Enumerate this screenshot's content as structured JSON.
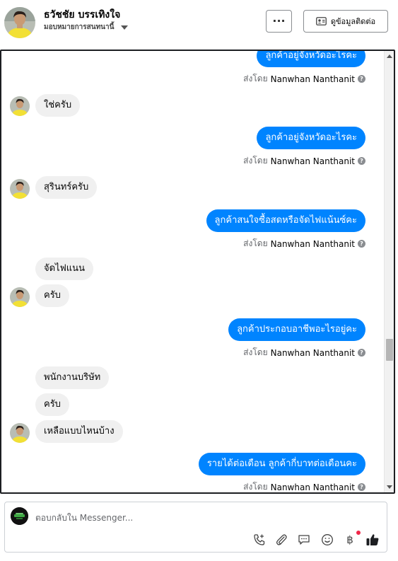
{
  "header": {
    "contact_name": "ธวัชชัย บรรเทิงใจ",
    "assign_label": "มอบหมายการสนทนานี้",
    "more_label": "···",
    "contact_info_label": "ดูข้อมูลติดต่อ"
  },
  "thread": {
    "sent_prefix": "ส่งโดย",
    "agent_name": "Nanwhan Nanthanit",
    "help_glyph": "?",
    "messages": [
      {
        "dir": "out",
        "text": "ลูกค้าอยู่จังหวัดอะไรคะ"
      },
      {
        "dir": "in",
        "text": "ใช่ครับ"
      },
      {
        "dir": "out",
        "text": "ลูกค้าอยู่จังหวัดอะไรคะ"
      },
      {
        "dir": "in",
        "text": "สุรินทร์ครับ"
      },
      {
        "dir": "out",
        "text": "ลูกค้าสนใจซื้อสดหรือจัดไฟแน้นซ์คะ"
      },
      {
        "dir": "in",
        "text": "จัดไฟแนน"
      },
      {
        "dir": "in",
        "text": "ครับ"
      },
      {
        "dir": "out",
        "text": "ลูกค้าประกอบอาชีพอะไรอยู่คะ"
      },
      {
        "dir": "in",
        "text": "พนักงานบริษัท"
      },
      {
        "dir": "in",
        "text": "ครับ"
      },
      {
        "dir": "in",
        "text": "เหลือแบบไหนบ้าง"
      },
      {
        "dir": "out",
        "text": "รายได้ต่อเดือน ลูกค้ากี่บาทต่อเดือนคะ"
      }
    ]
  },
  "composer": {
    "placeholder": "ตอบกลับใน Messenger...",
    "tools": [
      "add-call-icon",
      "attachment-icon",
      "saved-reply-icon",
      "emoji-icon",
      "payment-icon",
      "like-icon"
    ],
    "payment_glyph": "฿"
  },
  "colors": {
    "outgoing_bubble": "#0084ff",
    "incoming_bubble": "#f0f0f0",
    "notification_dot": "#f02849"
  }
}
